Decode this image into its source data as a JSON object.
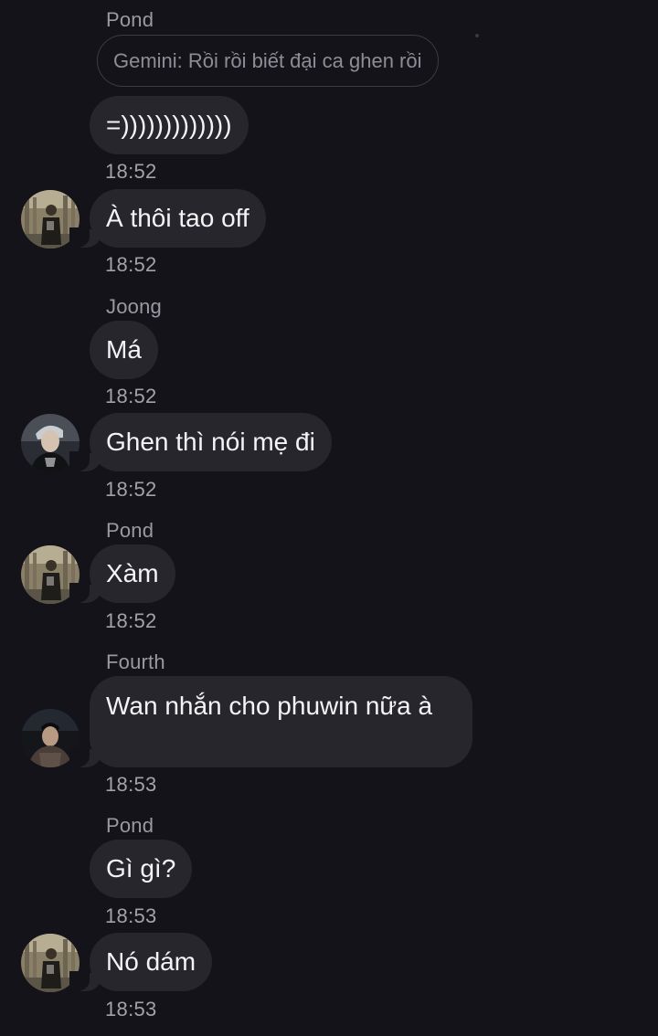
{
  "messages": [
    {
      "sender": "Pond",
      "reply_preview": "Gemini: Rồi rồi biết đại ca ghen rồi",
      "text": "=)))))))))))))",
      "time": "18:52"
    },
    {
      "text": "À thôi tao off",
      "time": "18:52",
      "avatar": "pond-avatar"
    },
    {
      "sender": "Joong",
      "text": "Má",
      "time": "18:52"
    },
    {
      "text": "Ghen thì nói mẹ đi",
      "time": "18:52",
      "avatar": "joong-avatar"
    },
    {
      "sender": "Pond",
      "text": "Xàm",
      "time": "18:52",
      "avatar": "pond-avatar"
    },
    {
      "sender": "Fourth",
      "text": "Wan nhắn cho phuwin nữa à",
      "time": "18:53",
      "avatar": "fourth-avatar"
    },
    {
      "sender": "Pond",
      "text": "Gì gì?",
      "time": "18:53"
    },
    {
      "text": "Nó dám",
      "time": "18:53",
      "avatar": "pond-avatar"
    }
  ],
  "colors": {
    "background": "#15131a",
    "bubble": "#27262c",
    "sender_text": "#9a99a0",
    "time_text": "#a3a2a8"
  }
}
